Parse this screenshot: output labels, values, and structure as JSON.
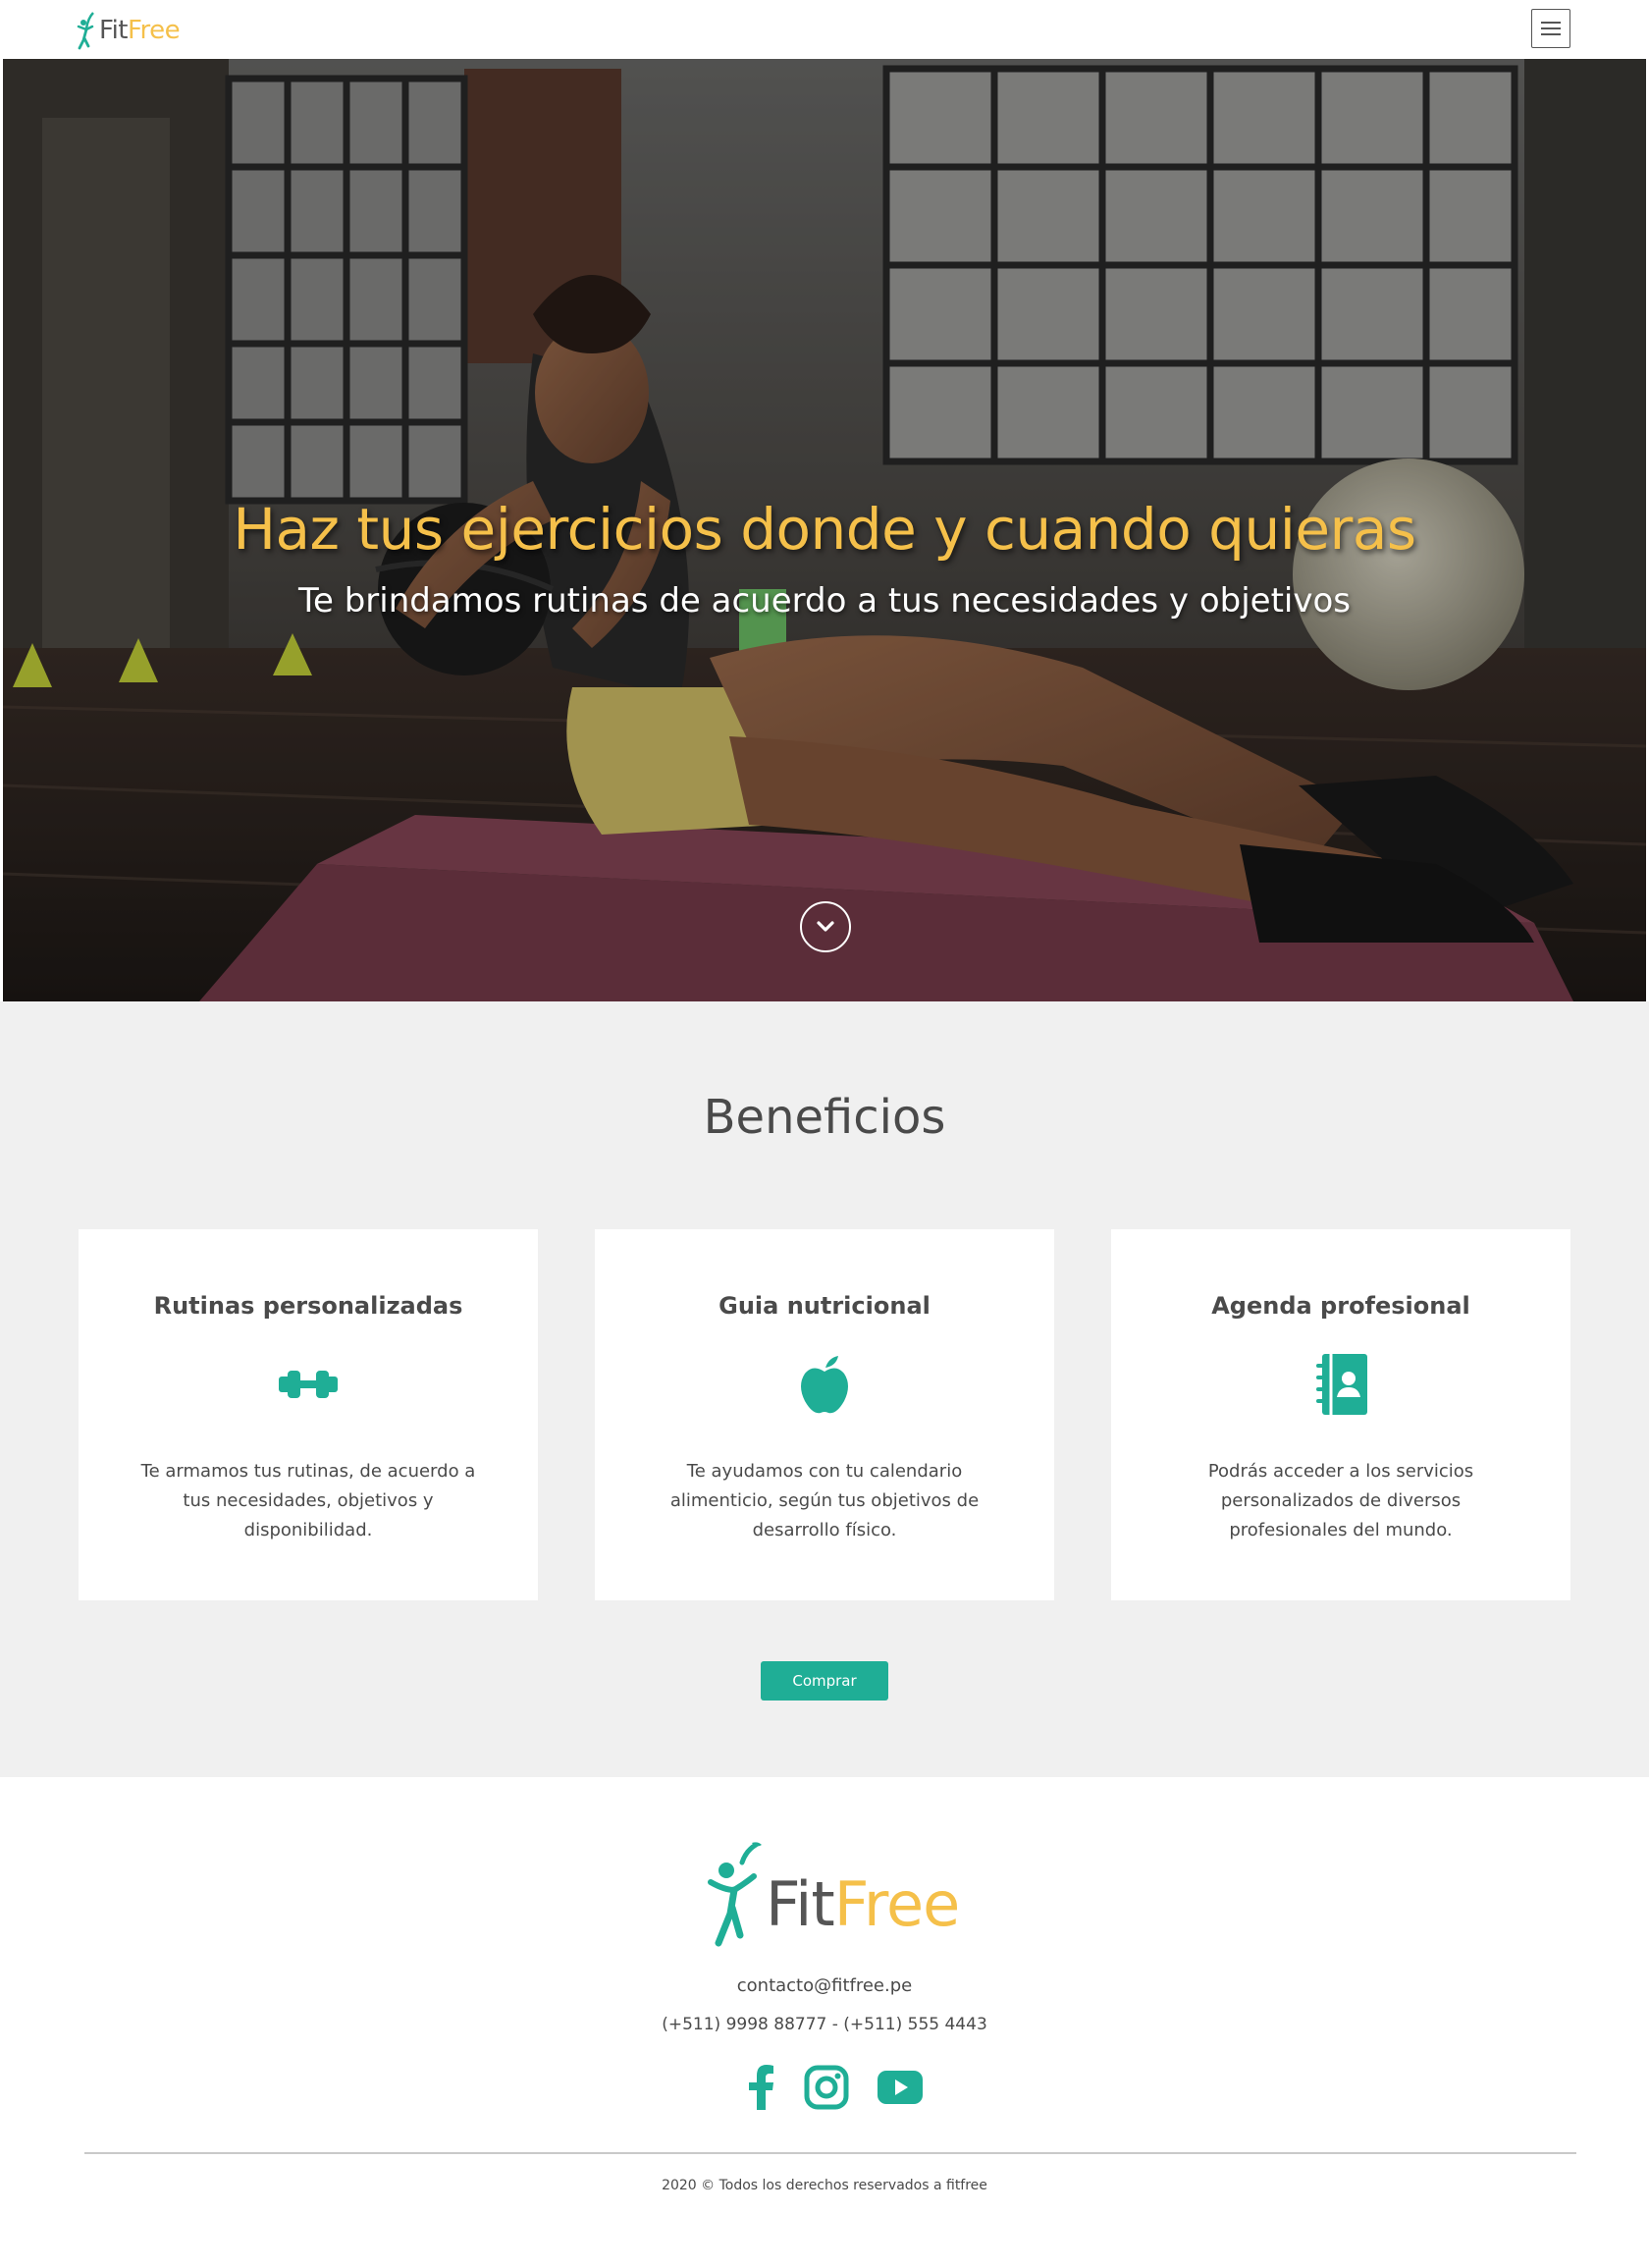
{
  "brand": {
    "part1": "Fit",
    "part2": "Free"
  },
  "nav": {
    "menu_icon": "hamburger-menu-icon"
  },
  "hero": {
    "title": "Haz tus ejercicios donde y cuando quieras",
    "subtitle": "Te brindamos rutinas de acuerdo a tus necesidades y objetivos",
    "scroll_icon": "chevron-down-icon"
  },
  "benefits": {
    "title": "Beneficios",
    "cards": [
      {
        "title": "Rutinas personalizadas",
        "icon": "dumbbell-icon",
        "text": "Te armamos tus rutinas, de acuerdo a tus necesidades, objetivos y disponibilidad."
      },
      {
        "title": "Guia nutricional",
        "icon": "apple-icon",
        "text": "Te ayudamos con tu calendario alimenticio, según tus objetivos de desarrollo físico."
      },
      {
        "title": "Agenda profesional",
        "icon": "address-book-icon",
        "text": "Podrás acceder a los servicios personalizados de diversos profesionales del mundo."
      }
    ],
    "button_label": "Comprar"
  },
  "footer": {
    "email": "contacto@fitfree.pe",
    "phone": "(+511) 9998 88777 - (+511) 555 4443",
    "socials": [
      "facebook-icon",
      "instagram-icon",
      "youtube-icon"
    ],
    "copyright": "2020 © Todos los derechos reservados a fitfree"
  },
  "colors": {
    "accent": "#1fae96",
    "brand_yellow": "#f5c04a",
    "text": "#4a4a4a",
    "section_bg": "#f0f0f0"
  }
}
